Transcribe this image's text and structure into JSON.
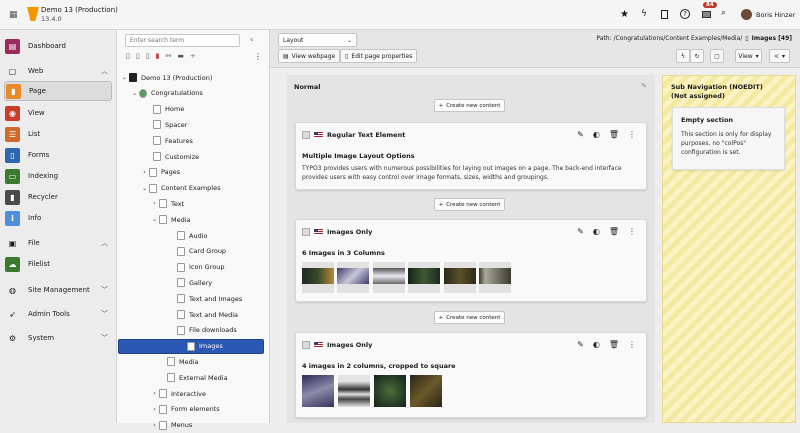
{
  "topbar": {
    "site_name": "Demo 13 (Production)",
    "version": "13.4.0",
    "notification_count": "84",
    "user_name": "Boris Hinzer"
  },
  "sidebar": {
    "dashboard": "Dashboard",
    "web": "Web",
    "file": "File",
    "site_management": "Site Management",
    "admin_tools": "Admin Tools",
    "system": "System",
    "web_modules": [
      {
        "label": "Page",
        "color": "#e8892c"
      },
      {
        "label": "View",
        "color": "#c83c2c"
      },
      {
        "label": "List",
        "color": "#cf6a2c"
      },
      {
        "label": "Forms",
        "color": "#2f66b3"
      },
      {
        "label": "Indexing",
        "color": "#3d7a2e"
      },
      {
        "label": "Recycler",
        "color": "#4a4a4a"
      },
      {
        "label": "Info",
        "color": "#4d90d9"
      }
    ],
    "file_modules": [
      {
        "label": "Filelist",
        "color": "#3d7a2e"
      }
    ]
  },
  "tree": {
    "search_placeholder": "Enter search term",
    "items": [
      "Demo 13 (Production)",
      "Congratulations",
      "Home",
      "Spacer",
      "Features",
      "Customize",
      "Pages",
      "Content Examples",
      "Text",
      "Media",
      "Audio",
      "Card Group",
      "Icon Group",
      "Gallery",
      "Text and Images",
      "Text and Media",
      "File downloads",
      "Images",
      "Media",
      "External Media",
      "Interactive",
      "Form elements",
      "Menus"
    ]
  },
  "docheader": {
    "layout_select": "Layout",
    "view_webpage": "View webpage",
    "edit_page_properties": "Edit page properties",
    "path_label": "Path: /Congratulations/Content Examples/Media/",
    "page_title": "Images [49]",
    "view_button": "View"
  },
  "content": {
    "column_title": "Normal",
    "create_new": "Create new content",
    "elements": [
      {
        "type": "Regular Text Element",
        "title": "Multiple Image Layout Options",
        "text": "TYPO3 provides users with numerous possibilities for laying out images on a page. The back-end interface provides users with easy control over image formats, sizes, widths and groupings."
      },
      {
        "type": "Images Only",
        "title": "6 Images in 3 Columns"
      },
      {
        "type": "Images Only",
        "title": "4 images in 2 columns, cropped to square"
      }
    ]
  },
  "subnav": {
    "title": "Sub Navigation (NOEDIT)",
    "subtitle": "(Not assigned)",
    "empty_title": "Empty section",
    "empty_text": "This section is only for display purposes, no \"colPos\" configuration is set."
  }
}
